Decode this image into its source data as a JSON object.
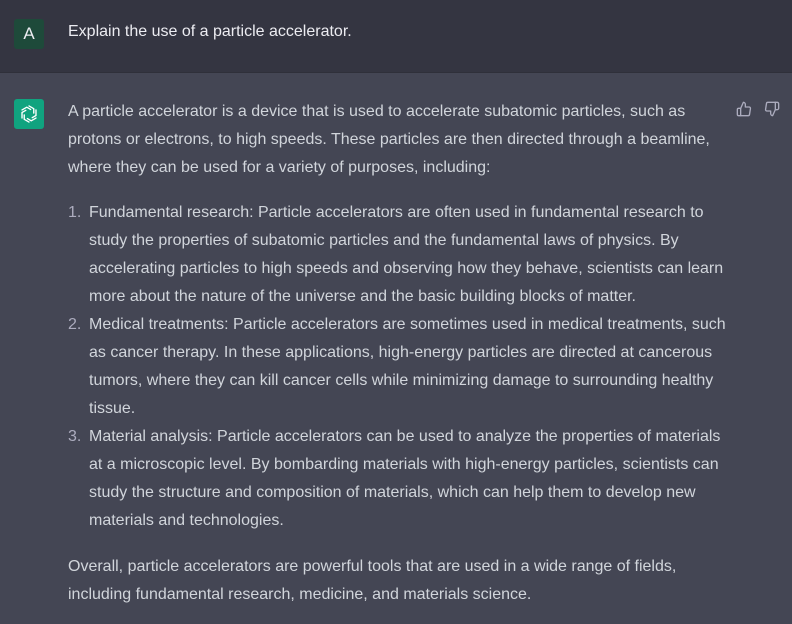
{
  "user": {
    "avatar_initial": "A",
    "prompt": "Explain the use of a particle accelerator."
  },
  "bot": {
    "icon": "openai-logo-icon",
    "brand_color": "#10a37f",
    "intro": "A particle accelerator is a device that is used to accelerate subatomic particles, such as protons or electrons, to high speeds. These particles are then directed through a beamline, where they can be used for a variety of purposes, including:",
    "items": [
      {
        "num": "1.",
        "text": "Fundamental research: Particle accelerators are often used in fundamental research to study the properties of subatomic particles and the fundamental laws of physics. By accelerating particles to high speeds and observing how they behave, scientists can learn more about the nature of the universe and the basic building blocks of matter."
      },
      {
        "num": "2.",
        "text": "Medical treatments: Particle accelerators are sometimes used in medical treatments, such as cancer therapy. In these applications, high-energy particles are directed at cancerous tumors, where they can kill cancer cells while minimizing damage to surrounding healthy tissue."
      },
      {
        "num": "3.",
        "text": "Material analysis: Particle accelerators can be used to analyze the properties of materials at a microscopic level. By bombarding materials with high-energy particles, scientists can study the structure and composition of materials, which can help them to develop new materials and technologies."
      }
    ],
    "conclusion": "Overall, particle accelerators are powerful tools that are used in a wide range of fields, including fundamental research, medicine, and materials science."
  },
  "feedback": {
    "thumbs_up_icon": "thumbs-up-icon",
    "thumbs_down_icon": "thumbs-down-icon"
  }
}
